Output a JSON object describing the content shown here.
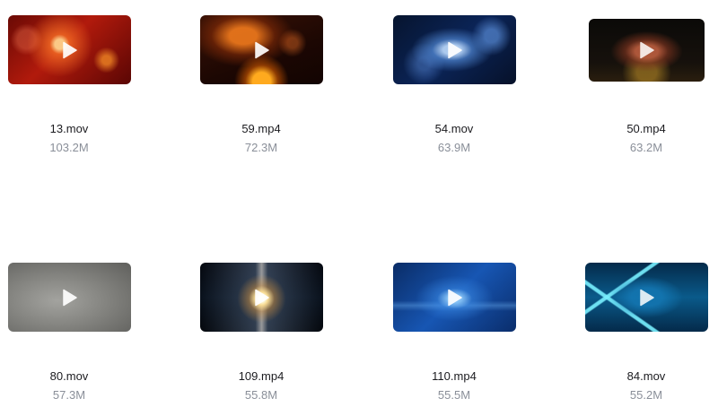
{
  "files": [
    {
      "name": "13.mov",
      "size": "103.2M",
      "thumbnail": "fire-red"
    },
    {
      "name": "59.mp4",
      "size": "72.3M",
      "thumbnail": "fire-sparks"
    },
    {
      "name": "54.mov",
      "size": "63.9M",
      "thumbnail": "blue-shards"
    },
    {
      "name": "50.mp4",
      "size": "63.2M",
      "thumbnail": "rust-3d"
    },
    {
      "name": "80.mov",
      "size": "57.3M",
      "thumbnail": "grey-studio"
    },
    {
      "name": "109.mp4",
      "size": "55.8M",
      "thumbnail": "lens-flare"
    },
    {
      "name": "110.mp4",
      "size": "55.5M",
      "thumbnail": "blue-digital"
    },
    {
      "name": "84.mov",
      "size": "55.2M",
      "thumbnail": "cyan-tunnel"
    }
  ],
  "icons": {
    "play": "play-icon"
  },
  "colors": {
    "name_text": "#1b1b1f",
    "size_text": "#8a8f99",
    "play_icon": "#ffffff"
  }
}
